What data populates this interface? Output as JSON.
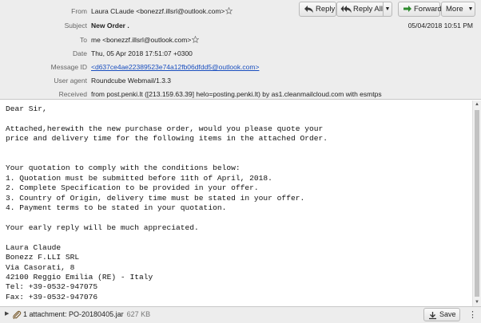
{
  "toolbar": {
    "reply_label": "Reply",
    "reply_all_label": "Reply All",
    "forward_label": "Forward",
    "more_label": "More"
  },
  "header": {
    "from_label": "From",
    "from_value": "Laura CLaude <bonezzf.illsrl@outlook.com>",
    "subject_label": "Subject",
    "subject_value": "New Order .",
    "to_label": "To",
    "to_value": "me <bonezzf.illsrl@outlook.com>",
    "date_label": "Date",
    "date_value": "Thu, 05 Apr 2018 17:51:07 +0300",
    "message_id_label": "Message ID",
    "message_id_value": "<d637ce4ae22389523e74a12fb06dfdd5@outlook.com>",
    "user_agent_label": "User agent",
    "user_agent_value": "Roundcube Webmail/1.3.3",
    "received_label": "Received",
    "received_value": "from post.penki.lt ([213.159.63.39] helo=posting.penki.lt) by as1.cleanmailcloud.com with esmtps",
    "display_date": "05/04/2018 10:51 PM"
  },
  "message_body": "Dear Sir,\n\nAttached,herewith the new purchase order, would you please quote your\nprice and delivery time for the following items in the attached Order.\n\n\nYour quotation to comply with the conditions below:\n1. Quotation must be submitted before 11th of April, 2018.\n2. Complete Specification to be provided in your offer.\n3. Country of Origin, delivery time must be stated in your offer.\n4. Payment terms to be stated in your quotation.\n\nYour early reply will be much appreciated.\n\nLaura Claude\nBonezz F.LLI SRL\nVia Casorati, 8\n42100 Reggio Emilia (RE) - Italy\nTel: +39-0532-947075\nFax: +39-0532-947076",
  "attachments": {
    "summary": "1 attachment: PO-20180405.jar",
    "size": "627 KB",
    "save_label": "Save"
  },
  "icons": {
    "reply": "reply-icon",
    "reply_all": "reply-all-icon",
    "forward": "forward-icon",
    "star": "star-icon",
    "paperclip": "paperclip-icon",
    "save": "download-icon"
  },
  "colors": {
    "header_bg": "#ededed",
    "link": "#1a4fbf",
    "forward_arrow": "#2e8b2e"
  }
}
